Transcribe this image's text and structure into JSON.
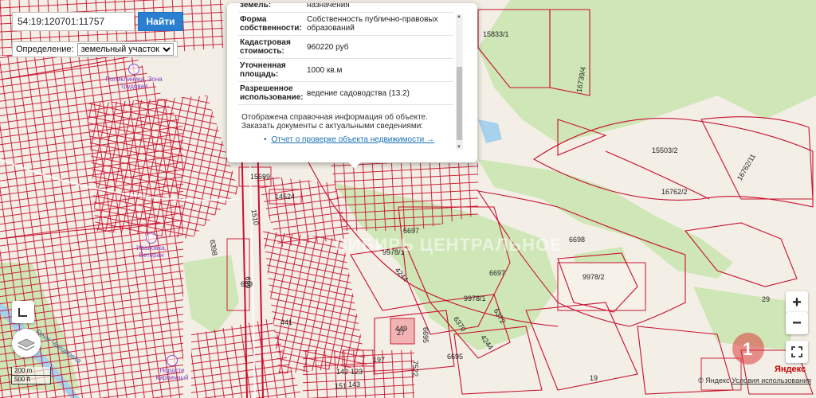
{
  "search": {
    "value": "54:19:120701:11757",
    "button_label": "Найти"
  },
  "definition": {
    "label": "Определение:",
    "selected": "земельный участок"
  },
  "popup": {
    "rows": [
      {
        "key": "земель:",
        "value": "назначения"
      },
      {
        "key": "Форма собственности:",
        "value": "Собственность публично-правовых образований"
      },
      {
        "key": "Кадастровая стоимость:",
        "value": "960220 руб"
      },
      {
        "key": "Уточненная площадь:",
        "value": "1000 кв.м"
      },
      {
        "key": "Разрешенное использование:",
        "value": "ведение садоводства (13.2)"
      }
    ],
    "info_text": "Отображена справочная информация об объекте. Заказать документы с актуальными сведениями:",
    "report_link": "Отчет о проверке объекта недвижимости →"
  },
  "map": {
    "plot_labels": [
      "15833/1",
      "16739/4",
      "15503/2",
      "16762/2",
      "16762/11",
      "15699",
      "14524",
      "6697",
      "9978/1",
      "6698",
      "6697",
      "9978/2",
      "9978/1",
      "4244",
      "6372",
      "6370",
      "4244",
      "449",
      "6695",
      "7522",
      "197",
      "689",
      "441",
      "1510",
      "6398",
      "123",
      "142",
      "143",
      "151",
      "6695",
      "19",
      "29",
      "689",
      "27"
    ],
    "poi": [
      "Поликлиника, Зона Трудовая",
      "Ивановка, Ветеран",
      "Нордсте Кирпичный"
    ],
    "river_label": "Река Чигировка",
    "watermark": "СИБИРЬ ЦЕНТРАЛЬНОЕ"
  },
  "controls": {
    "zoom_in": "+",
    "zoom_out": "−"
  },
  "scale": {
    "metric": "200 m",
    "imperial": "500 ft"
  },
  "footer": {
    "brand": "© Яндекс",
    "terms": "Условия использования"
  },
  "logo_text": "Яндекс",
  "colors": {
    "parcel_stroke": "#c8102e",
    "green_area": "#c9e4b1",
    "water": "#a7d2ee",
    "button_blue": "#2b7fd0"
  }
}
